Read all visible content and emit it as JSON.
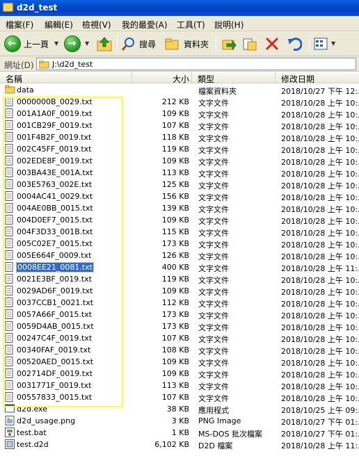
{
  "window": {
    "title": "d2d_test"
  },
  "menu": [
    "檔案(F)",
    "編輯(E)",
    "檢視(V)",
    "我的最愛(A)",
    "工具(T)",
    "說明(H)"
  ],
  "toolbar": {
    "back_label": "上一頁",
    "search_label": "搜尋",
    "folders_label": "資料夾"
  },
  "address": {
    "label": "網址(D)",
    "path": "J:\\d2d_test"
  },
  "columns": {
    "name": "名稱",
    "size": "大小",
    "type": "類型",
    "date": "修改日期"
  },
  "files": [
    {
      "name": "data",
      "size": "",
      "type": "檔案資料夾",
      "date": "2018/10/27 下午 12:...",
      "icon": "folder-icon"
    },
    {
      "name": "0000000B_0029.txt",
      "size": "212 KB",
      "type": "文字文件",
      "date": "2018/10/28 上午 10:...",
      "icon": "text-file-icon"
    },
    {
      "name": "001A1A0F_0019.txt",
      "size": "109 KB",
      "type": "文字文件",
      "date": "2018/10/28 上午 10:...",
      "icon": "text-file-icon"
    },
    {
      "name": "001CB29F_0019.txt",
      "size": "107 KB",
      "type": "文字文件",
      "date": "2018/10/28 上午 10:...",
      "icon": "text-file-icon"
    },
    {
      "name": "001F4B2F_0019.txt",
      "size": "118 KB",
      "type": "文字文件",
      "date": "2018/10/28 上午 10:...",
      "icon": "text-file-icon"
    },
    {
      "name": "002C45FF_0019.txt",
      "size": "119 KB",
      "type": "文字文件",
      "date": "2018/10/28 上午 10:...",
      "icon": "text-file-icon"
    },
    {
      "name": "002EDE8F_0019.txt",
      "size": "109 KB",
      "type": "文字文件",
      "date": "2018/10/28 上午 10:...",
      "icon": "text-file-icon"
    },
    {
      "name": "003BA43E_001A.txt",
      "size": "113 KB",
      "type": "文字文件",
      "date": "2018/10/28 上午 10:...",
      "icon": "text-file-icon"
    },
    {
      "name": "003E5763_002E.txt",
      "size": "125 KB",
      "type": "文字文件",
      "date": "2018/10/28 上午 10:...",
      "icon": "text-file-icon"
    },
    {
      "name": "0004AC41_0029.txt",
      "size": "156 KB",
      "type": "文字文件",
      "date": "2018/10/28 上午 10:...",
      "icon": "text-file-icon"
    },
    {
      "name": "004AE0BB_0015.txt",
      "size": "139 KB",
      "type": "文字文件",
      "date": "2018/10/28 上午 10:...",
      "icon": "text-file-icon"
    },
    {
      "name": "004D0EF7_0015.txt",
      "size": "109 KB",
      "type": "文字文件",
      "date": "2018/10/28 上午 10:...",
      "icon": "text-file-icon"
    },
    {
      "name": "004F3D33_001B.txt",
      "size": "115 KB",
      "type": "文字文件",
      "date": "2018/10/28 上午 10:...",
      "icon": "text-file-icon"
    },
    {
      "name": "005C02E7_0015.txt",
      "size": "173 KB",
      "type": "文字文件",
      "date": "2018/10/28 上午 10:...",
      "icon": "text-file-icon"
    },
    {
      "name": "005E664F_0009.txt",
      "size": "126 KB",
      "type": "文字文件",
      "date": "2018/10/28 上午 10:...",
      "icon": "text-file-icon"
    },
    {
      "name": "0008EE21_0081.txt",
      "size": "400 KB",
      "type": "文字文件",
      "date": "2018/10/28 上午 11:...",
      "icon": "text-file-icon",
      "selected": true
    },
    {
      "name": "0021E3BF_0019.txt",
      "size": "119 KB",
      "type": "文字文件",
      "date": "2018/10/28 上午 10:...",
      "icon": "text-file-icon"
    },
    {
      "name": "0029AD6F_0019.txt",
      "size": "109 KB",
      "type": "文字文件",
      "date": "2018/10/28 上午 10:...",
      "icon": "text-file-icon"
    },
    {
      "name": "0037CCB1_0021.txt",
      "size": "112 KB",
      "type": "文字文件",
      "date": "2018/10/28 上午 10:...",
      "icon": "text-file-icon"
    },
    {
      "name": "0057A66F_0015.txt",
      "size": "173 KB",
      "type": "文字文件",
      "date": "2018/10/28 上午 10:...",
      "icon": "text-file-icon"
    },
    {
      "name": "0059D4AB_0015.txt",
      "size": "173 KB",
      "type": "文字文件",
      "date": "2018/10/28 上午 10:...",
      "icon": "text-file-icon"
    },
    {
      "name": "00247C4F_0019.txt",
      "size": "107 KB",
      "type": "文字文件",
      "date": "2018/10/28 上午 10:...",
      "icon": "text-file-icon"
    },
    {
      "name": "00340FAF_0019.txt",
      "size": "108 KB",
      "type": "文字文件",
      "date": "2018/10/28 上午 10:...",
      "icon": "text-file-icon"
    },
    {
      "name": "00520AED_0015.txt",
      "size": "109 KB",
      "type": "文字文件",
      "date": "2018/10/28 上午 10:...",
      "icon": "text-file-icon"
    },
    {
      "name": "002714DF_0019.txt",
      "size": "109 KB",
      "type": "文字文件",
      "date": "2018/10/28 上午 10:...",
      "icon": "text-file-icon"
    },
    {
      "name": "0031771F_0019.txt",
      "size": "113 KB",
      "type": "文字文件",
      "date": "2018/10/28 上午 10:...",
      "icon": "text-file-icon"
    },
    {
      "name": "00557833_0015.txt",
      "size": "107 KB",
      "type": "文字文件",
      "date": "2018/10/28 上午 10:...",
      "icon": "text-file-icon"
    },
    {
      "name": "d2d.exe",
      "size": "38 KB",
      "type": "應用程式",
      "date": "2018/10/25 上午 09:...",
      "icon": "exe-icon"
    },
    {
      "name": "d2d_usage.png",
      "size": "3 KB",
      "type": "PNG Image",
      "date": "2018/10/27 下午 01:...",
      "icon": "image-file-icon"
    },
    {
      "name": "test.bat",
      "size": "1 KB",
      "type": "MS-DOS 批次檔案",
      "date": "2018/10/27 下午 01:...",
      "icon": "batch-file-icon"
    },
    {
      "name": "test.d2d",
      "size": "6,102 KB",
      "type": "D2D 檔案",
      "date": "2018/10/28 上午 11:...",
      "icon": "d2d-file-icon"
    }
  ],
  "colors": {
    "highlight_box": "#ffff33",
    "selection": "#316ac5",
    "titlebar": "#0a5fe0"
  }
}
